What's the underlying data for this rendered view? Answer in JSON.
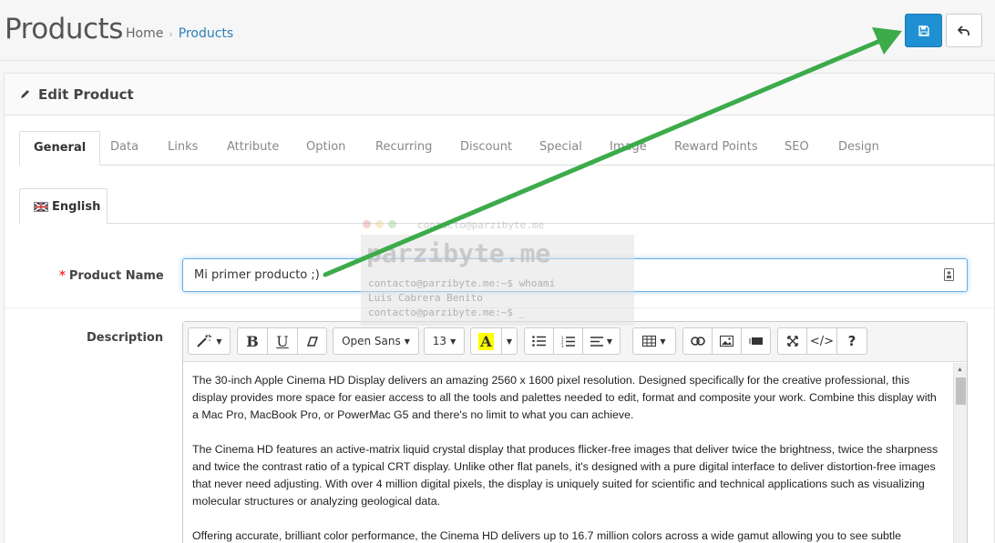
{
  "header": {
    "title": "Products",
    "breadcrumb": {
      "home": "Home",
      "separator": "›",
      "current": "Products"
    }
  },
  "actions": {
    "save_icon": "floppy-disk-icon",
    "back_icon": "reply-arrow-icon"
  },
  "panel": {
    "title": "Edit Product",
    "icon": "pencil-icon"
  },
  "tabs": [
    "General",
    "Data",
    "Links",
    "Attribute",
    "Option",
    "Recurring",
    "Discount",
    "Special",
    "Image",
    "Reward Points",
    "SEO",
    "Design"
  ],
  "active_tab": "General",
  "language_tab": "English",
  "form": {
    "product_name_label": "Product Name",
    "required_mark": "*",
    "product_name_value": "Mi primer producto ;)",
    "description_label": "Description"
  },
  "editor": {
    "toolbar": {
      "font_family": "Open Sans",
      "font_size": "13",
      "help_label": "?",
      "codeview_label": "</>"
    },
    "paragraphs": [
      "The 30-inch Apple Cinema HD Display delivers an amazing 2560 x 1600 pixel resolution. Designed specifically for the creative professional, this display provides more space for easier access to all the tools and palettes needed to edit, format and composite your work. Combine this display with a Mac Pro, MacBook Pro, or PowerMac G5 and there's no limit to what you can achieve.",
      "The Cinema HD features an active-matrix liquid crystal display that produces flicker-free images that deliver twice the brightness, twice the sharpness and twice the contrast ratio of a typical CRT display. Unlike other flat panels, it's designed with a pure digital interface to deliver distortion-free images that never need adjusting. With over 4 million digital pixels, the display is uniquely suited for scientific and technical applications such as visualizing molecular structures or analyzing geological data.",
      "Offering accurate, brilliant color performance, the Cinema HD delivers up to 16.7 million colors across a wide gamut allowing you to see subtle"
    ]
  },
  "watermark": {
    "top": "contacto@parzibyte.me",
    "big": "parzibyte.me",
    "line1": "contacto@parzibyte.me:~$ whoami",
    "line2": "Luis Cabrera Benito",
    "line3": "contacto@parzibyte.me:~$ _"
  },
  "colors": {
    "primary": "#1f90d2",
    "link": "#2a7fb8",
    "arrow": "#3cab4a",
    "required": "#ee3333"
  }
}
